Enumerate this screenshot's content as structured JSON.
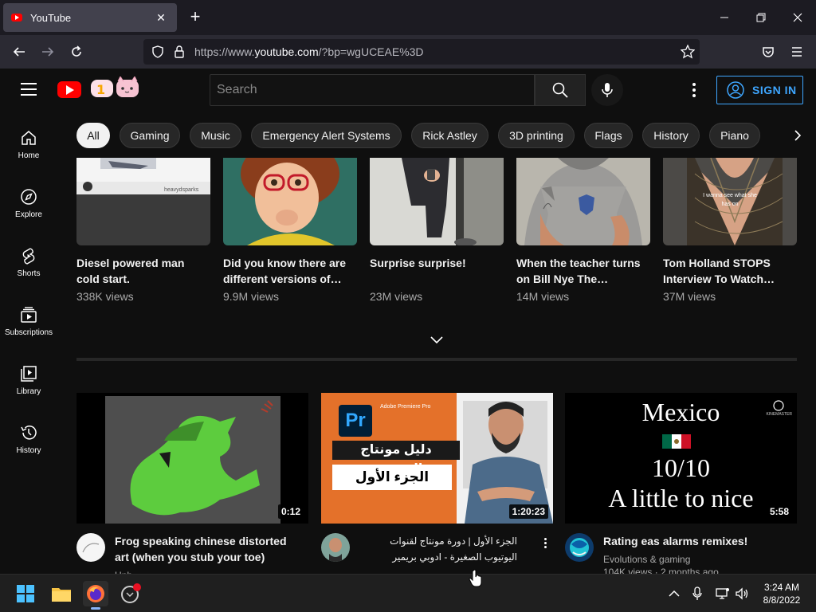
{
  "browser": {
    "tab_title": "YouTube",
    "url_prefix": "https://www.",
    "url_domain": "youtube.com",
    "url_rest": "/?bp=wgUCEAE%3D"
  },
  "header": {
    "search_placeholder": "Search",
    "sign_in": "SIGN IN"
  },
  "sidebar": {
    "items": [
      {
        "label": "Home",
        "icon": "home-icon"
      },
      {
        "label": "Explore",
        "icon": "compass-icon"
      },
      {
        "label": "Shorts",
        "icon": "shorts-icon"
      },
      {
        "label": "Subscriptions",
        "icon": "subscriptions-icon"
      },
      {
        "label": "Library",
        "icon": "library-icon"
      },
      {
        "label": "History",
        "icon": "history-icon"
      }
    ]
  },
  "chips": [
    "All",
    "Gaming",
    "Music",
    "Emergency Alert Systems",
    "Rick Astley",
    "3D printing",
    "Flags",
    "History",
    "Piano"
  ],
  "shorts": [
    {
      "title": "Diesel powered man cold start.",
      "views": "338K views",
      "watermark": "heavydsparks"
    },
    {
      "title": "Did you know there are different versions of…",
      "views": "9.9M views"
    },
    {
      "title": "Surprise surprise!",
      "views": "23M views"
    },
    {
      "title": "When the teacher turns on Bill Nye The…",
      "views": "14M views"
    },
    {
      "title": "Tom Holland STOPS Interview To Watch…",
      "views": "37M views",
      "caption": "I wanna see what she has on"
    }
  ],
  "videos": [
    {
      "title": "Frog speaking chinese distorted art (when you stub your toe)",
      "channel": "Unb…",
      "duration": "0:12"
    },
    {
      "title": "الجزء الأول | دورة مونتاج لقنوات اليوتيوب الصغيرة - ادوبي بريمير",
      "channel": "",
      "duration": "1:20:23",
      "thumb_line1": "دليل مونتاج اليوتيوب",
      "thumb_line2": "الجزء الأول",
      "thumb_badge": "Pr",
      "thumb_brand": "Adobe Premiere Pro"
    },
    {
      "title": "Rating eas alarms remixes!",
      "channel": "Evolutions & gaming",
      "stats": "104K views · 2 months ago",
      "duration": "5:58",
      "thumb_line1": "Mexico",
      "thumb_line2": "10/10",
      "thumb_line3": "A little to nice",
      "thumb_brand": "KINEMASTER"
    }
  ],
  "taskbar": {
    "time": "3:24 AM",
    "date": "8/8/2022"
  },
  "colors": {
    "accent": "#3ea6ff",
    "brand": "#ff0000",
    "background": "#0f0f0f"
  }
}
